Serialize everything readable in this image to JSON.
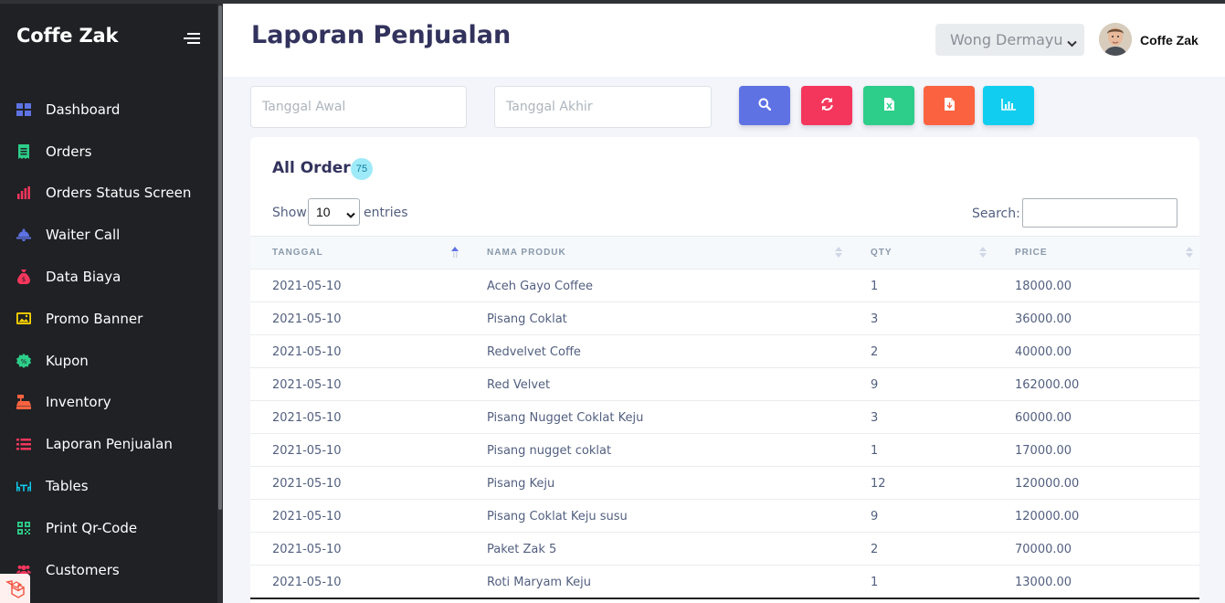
{
  "app": {
    "brand": "Coffe Zak"
  },
  "sidebar": {
    "items": [
      {
        "label": "Dashboard",
        "icon": "dashboard-icon",
        "color": "#5e72e4"
      },
      {
        "label": "Orders",
        "icon": "receipt-icon",
        "color": "#2dce89"
      },
      {
        "label": "Orders Status Screen",
        "icon": "bar-chart-icon",
        "color": "#f5365c"
      },
      {
        "label": "Waiter Call",
        "icon": "bell-icon",
        "color": "#5e72e4"
      },
      {
        "label": "Data Biaya",
        "icon": "money-bag-icon",
        "color": "#f5365c"
      },
      {
        "label": "Promo Banner",
        "icon": "image-icon",
        "color": "#ffd600"
      },
      {
        "label": "Kupon",
        "icon": "coupon-icon",
        "color": "#2dce89"
      },
      {
        "label": "Inventory",
        "icon": "cash-register-icon",
        "color": "#fb6340"
      },
      {
        "label": "Laporan Penjualan",
        "icon": "list-icon",
        "color": "#f5365c"
      },
      {
        "label": "Tables",
        "icon": "table-chairs-icon",
        "color": "#11cdef"
      },
      {
        "label": "Print Qr-Code",
        "icon": "qrcode-icon",
        "color": "#2dce89"
      },
      {
        "label": "Customers",
        "icon": "users-icon",
        "color": "#f5365c"
      }
    ]
  },
  "header": {
    "title": "Laporan Penjualan",
    "branch": "Wong Dermayu",
    "user": "Coffe Zak"
  },
  "filters": {
    "start_placeholder": "Tanggal Awal",
    "end_placeholder": "Tanggal Akhir",
    "buttons": [
      {
        "name": "search-button",
        "icon": "search-icon",
        "color": "#5e72e4"
      },
      {
        "name": "refresh-button",
        "icon": "refresh-icon",
        "color": "#f5365c"
      },
      {
        "name": "export-excel-button",
        "icon": "excel-file-icon",
        "color": "#2dce89"
      },
      {
        "name": "export-pdf-button",
        "icon": "pdf-file-icon",
        "color": "#fb6340"
      },
      {
        "name": "chart-button",
        "icon": "chart-icon",
        "color": "#11cdef"
      }
    ]
  },
  "orders": {
    "title": "All Orders",
    "count": "75",
    "show_label": "Show",
    "entries_value": "10",
    "entries_label": "entries",
    "search_label": "Search:",
    "columns": [
      "TANGGAL",
      "NAMA PRODUK",
      "QTY",
      "PRICE"
    ],
    "rows": [
      [
        "2021-05-10",
        "Aceh Gayo Coffee",
        "1",
        "18000.00"
      ],
      [
        "2021-05-10",
        "Pisang Coklat",
        "3",
        "36000.00"
      ],
      [
        "2021-05-10",
        "Redvelvet Coffe",
        "2",
        "40000.00"
      ],
      [
        "2021-05-10",
        "Red Velvet",
        "9",
        "162000.00"
      ],
      [
        "2021-05-10",
        "Pisang Nugget Coklat Keju",
        "3",
        "60000.00"
      ],
      [
        "2021-05-10",
        "Pisang nugget coklat",
        "1",
        "17000.00"
      ],
      [
        "2021-05-10",
        "Pisang Keju",
        "12",
        "120000.00"
      ],
      [
        "2021-05-10",
        "Pisang Coklat Keju susu",
        "9",
        "120000.00"
      ],
      [
        "2021-05-10",
        "Paket Zak 5",
        "2",
        "70000.00"
      ],
      [
        "2021-05-10",
        "Roti Maryam Keju",
        "1",
        "13000.00"
      ]
    ]
  }
}
